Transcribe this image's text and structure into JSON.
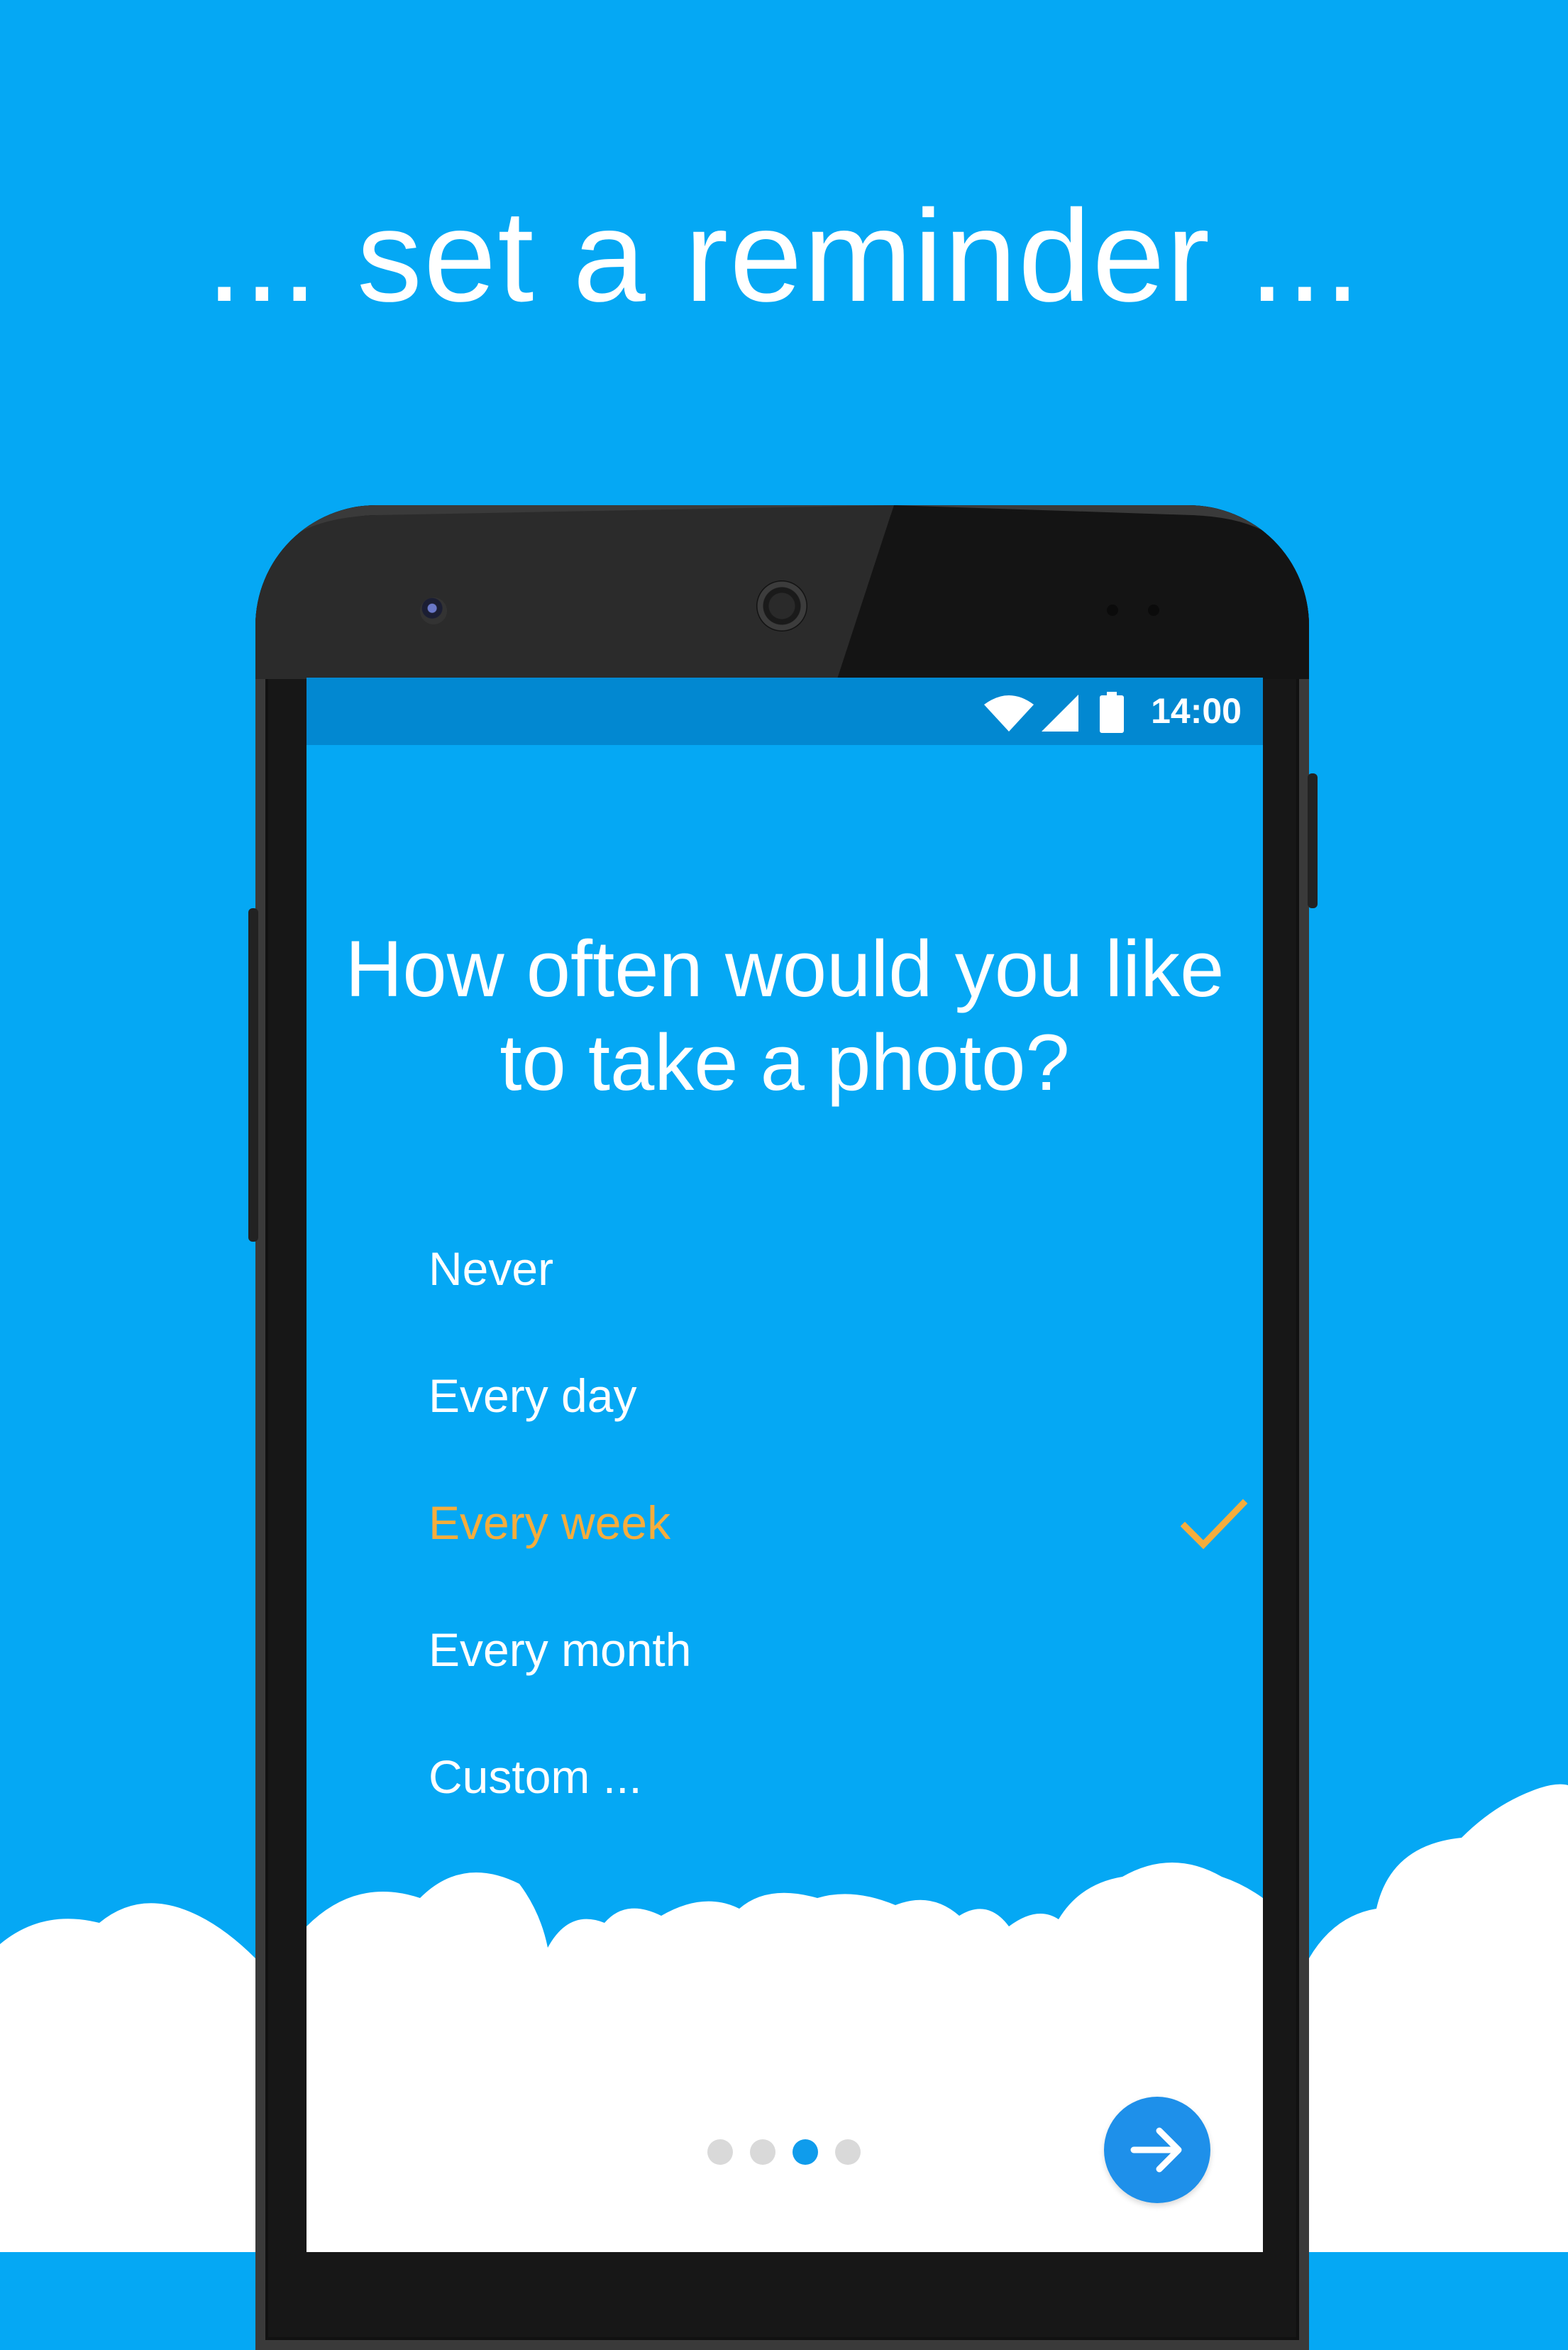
{
  "headline": "... set a reminder ...",
  "status_bar": {
    "time": "14:00",
    "icons": [
      "wifi-icon",
      "signal-icon",
      "battery-icon"
    ]
  },
  "question": {
    "line1": "How often would you like",
    "line2": "to take a photo?"
  },
  "options": [
    {
      "label": "Never",
      "selected": false
    },
    {
      "label": "Every day",
      "selected": false
    },
    {
      "label": "Every week",
      "selected": true
    },
    {
      "label": "Every month",
      "selected": false
    },
    {
      "label": "Custom ...",
      "selected": false
    }
  ],
  "pager": {
    "pages": 4,
    "current": 3
  },
  "next_button": {
    "icon": "arrow-right-icon"
  },
  "colors": {
    "background": "#05a8f4",
    "status_bar": "#0288d1",
    "selected_option": "#f6ad3c",
    "next_button": "#1e90ea"
  }
}
